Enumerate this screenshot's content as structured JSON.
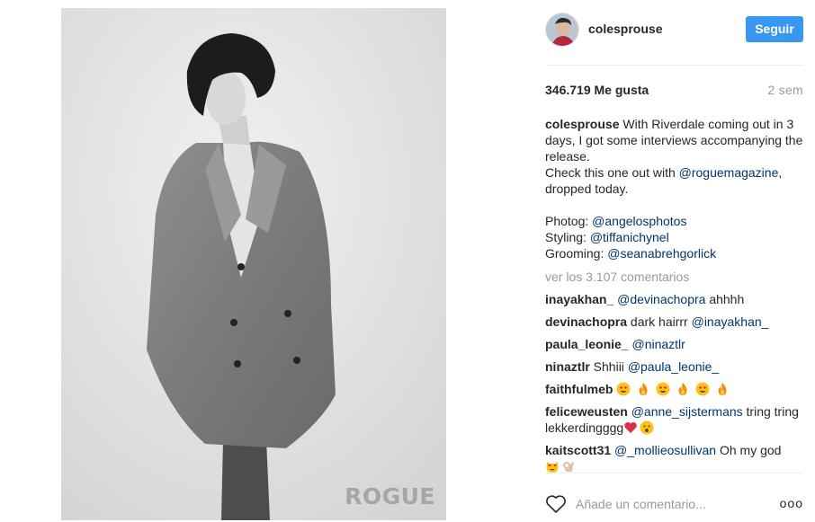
{
  "post": {
    "watermark": "ROGUE",
    "username": "colesprouse",
    "follow_label": "Seguir",
    "likes": "346.719 Me gusta",
    "time_ago": "2 sem",
    "caption_user": "colesprouse",
    "caption_line1": "With Riverdale coming out in 3 days, I got some interviews accompanying the release.",
    "caption_line2_pre": "Check this one out with ",
    "caption_line2_mention": "@roguemagazine",
    "caption_line2_post": ", dropped today.",
    "credits": [
      {
        "label": "Photog: ",
        "mention": "@angelosphotos"
      },
      {
        "label": "Styling: ",
        "mention": "@tiffanichynel"
      },
      {
        "label": "Grooming: ",
        "mention": "@seanabrehgorlick"
      }
    ],
    "view_all": "ver los 3.107 comentarios"
  },
  "comments": [
    {
      "user": "inayakhan_",
      "mention": "@devinachopra",
      "text": " ahhhh"
    },
    {
      "user": "devinachopra",
      "text": "dark hairrr ",
      "mention": "@inayakhan_"
    },
    {
      "user": "paula_leonie_",
      "mention": "@ninaztlr"
    },
    {
      "user": "ninaztlr",
      "text": "Shhiii ",
      "mention": "@paula_leonie_"
    },
    {
      "user": "faithfulmeb",
      "emojis": [
        "heart-eyes-emoji",
        "fire-emoji",
        "heart-eyes-emoji",
        "fire-emoji",
        "heart-eyes-emoji",
        "fire-emoji"
      ]
    },
    {
      "user": "feliceweusten",
      "mention": "@anne_sijstermans",
      "text": " tring tring lekkerdingggg",
      "emojis": [
        "red-heart-emoji",
        "surprised-emoji"
      ]
    },
    {
      "user": "kaitscott31",
      "mention": "@_mollieosullivan",
      "text": " Oh my god",
      "emojis": [
        "heart-eyes-cat-emoji",
        "ok-hand-emoji"
      ]
    }
  ],
  "add_comment": {
    "placeholder": "Añade un comentario...",
    "more": "ooo"
  },
  "colors": {
    "follow": "#3897f0",
    "mention": "#003569",
    "muted": "#999999"
  }
}
